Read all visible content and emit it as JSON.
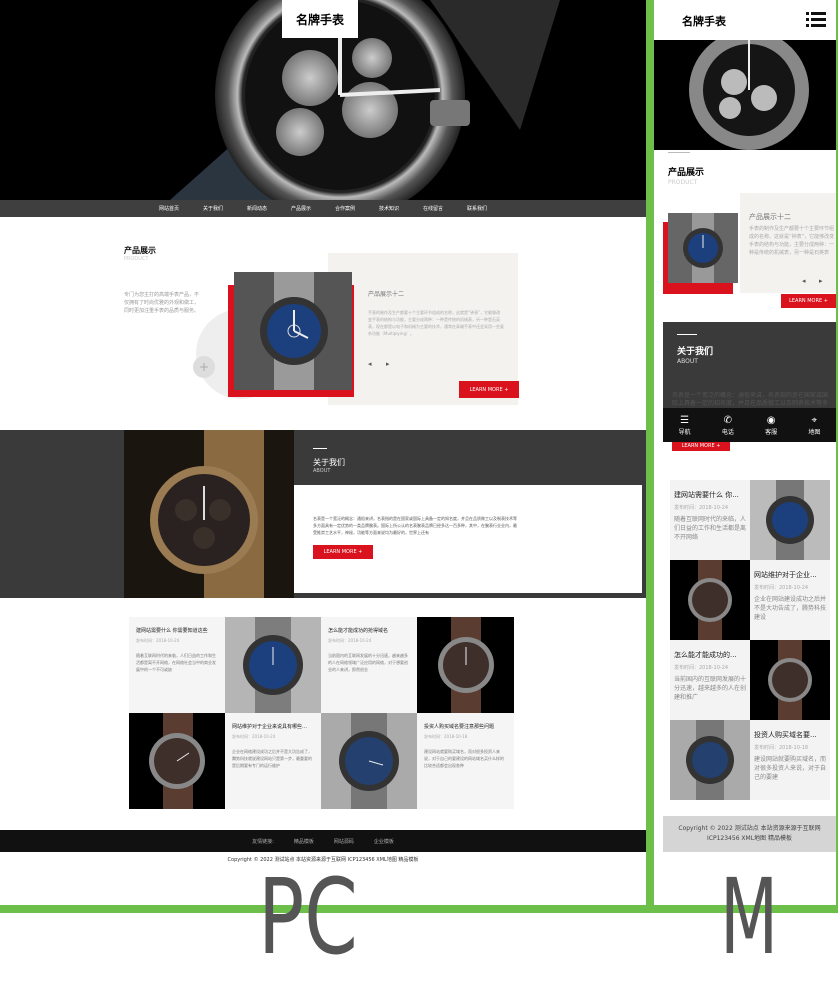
{
  "labels": {
    "pc": "PC",
    "mobile": "M"
  },
  "pc": {
    "logo": "名牌手表",
    "nav": [
      "网站首页",
      "关于我们",
      "新闻动态",
      "产品展示",
      "合作案例",
      "技术知识",
      "在线留言",
      "联系我们"
    ],
    "product": {
      "title": "产品展示",
      "subtitle": "PRODUCT",
      "intro": "专门为您主打的高端手表产品，不仅拥有了时尚优雅的外观和做工，同时更加注重手表的品质与服务。",
      "item_title": "产品展示十二",
      "item_desc": "手表的制作及生产都要十个主要环节组成的名称。这就是“钟表”，它能够改变手表的结构与功能，主要分成两种：一种是传统的机械表，另一种是石英表，现在都是以电子和机械为主要的技术，通常在高端手表中还会采用一些复杂功能（Multiplying）。",
      "more": "LEARN MORE +"
    },
    "about": {
      "title": "关于我们",
      "subtitle": "ABOUT",
      "text": "名表是一个宽泛的概念：通俗来讲，名表指的是在国家或国际上具备一定的知名度，并且在品质做工以及制表技术等多方面具有一定优势的一类品牌腕表。国际上所公认的名表腕表品牌已经多达一百多种，其中，在腕表行业业内，最受推崇工艺水平，神秘，功能等方面来说均为最好的，世界上还有",
      "more": "LEARN MORE +"
    },
    "news": [
      {
        "title": "建网站需要什么 你需要知道这些",
        "date": "发布时间：2018-10-24",
        "desc": "随着互联网时代的来临，人们日益的工作和生活都是离不开网络，在网络社会当中的商业发展中的一个不可或缺"
      },
      {
        "title": "怎么能才能成功的抢得域名",
        "date": "发布时间：2018-10-24",
        "desc": "当前国内的互联网发展的十分迅速，越来越多的人在网络领域广泛应用的网络，对于想要创业的人来讲，即然创业"
      },
      {
        "title": "网站维护对于企业来说具有哪些…",
        "date": "发布时间：2018-10-24",
        "desc": "企业在网络建设成功之后并不是大功告成了，腾势科技就说建设网站只是第一步，最重要的是后期要有专门的运行维护"
      },
      {
        "title": "投资人购买域名要注意那些问题",
        "date": "发布时间：2018-10-18",
        "desc": "建设网站就要购买域名，而对很多投资人来说，对于自己的要建设的网站域名买什么样的比较合适都会出现各种"
      }
    ],
    "footer": [
      "友情链接:",
      "精品模板",
      "网站源码",
      "企业模板"
    ],
    "copyright": "Copyright © 2022 测试站点 本站资源来源于互联网 ICP123456 XML地图 精品模板"
  },
  "mobile": {
    "logo": "名牌手表",
    "product": {
      "title": "产品展示",
      "subtitle": "PRODUCT",
      "item_title": "产品展示十二",
      "item_desc": "手表的制作及生产都要十个主要环节组成的名称。这就是“钟表”，它能够改变手表的结构与功能，主要分成两种：一种是传统的机械表，另一种是石英表",
      "more": "LEARN MORE +"
    },
    "about": {
      "title": "关于我们",
      "subtitle": "ABOUT",
      "text": "名表是一个宽泛的概念：通俗来讲，名表指的是在国家或国际上具备一定的知名度，并且在品质做工以及制表技术等多方面具有",
      "more": "LEARN MORE +"
    },
    "bottom_nav": [
      "导航",
      "电话",
      "客服",
      "地图"
    ],
    "news": [
      {
        "title": "建网站需要什么 你...",
        "date": "发布时间：2018-10-24",
        "desc": "随着互联网时代的来临，人们日益的工作和生活都是离不开网络"
      },
      {
        "title": "网站维护对于企业...",
        "date": "发布时间：2018-10-24",
        "desc": "企业在网站建设成功之后并不是大功告成了，腾势科技建设"
      },
      {
        "title": "怎么能才能成功的...",
        "date": "发布时间：2018-10-24",
        "desc": "当前国内的互联网发展的十分迅速，越来越多的人在创建和推广"
      },
      {
        "title": "投资人购买域名要...",
        "date": "发布时间：2018-10-18",
        "desc": "建设网站就要购买域名，而对很多投资人来说，对于自己的要建"
      }
    ],
    "copyright": "Copyright © 2022 测试站点 本站资源来源于互联网 ICP123456 XML地图 精品模板"
  }
}
